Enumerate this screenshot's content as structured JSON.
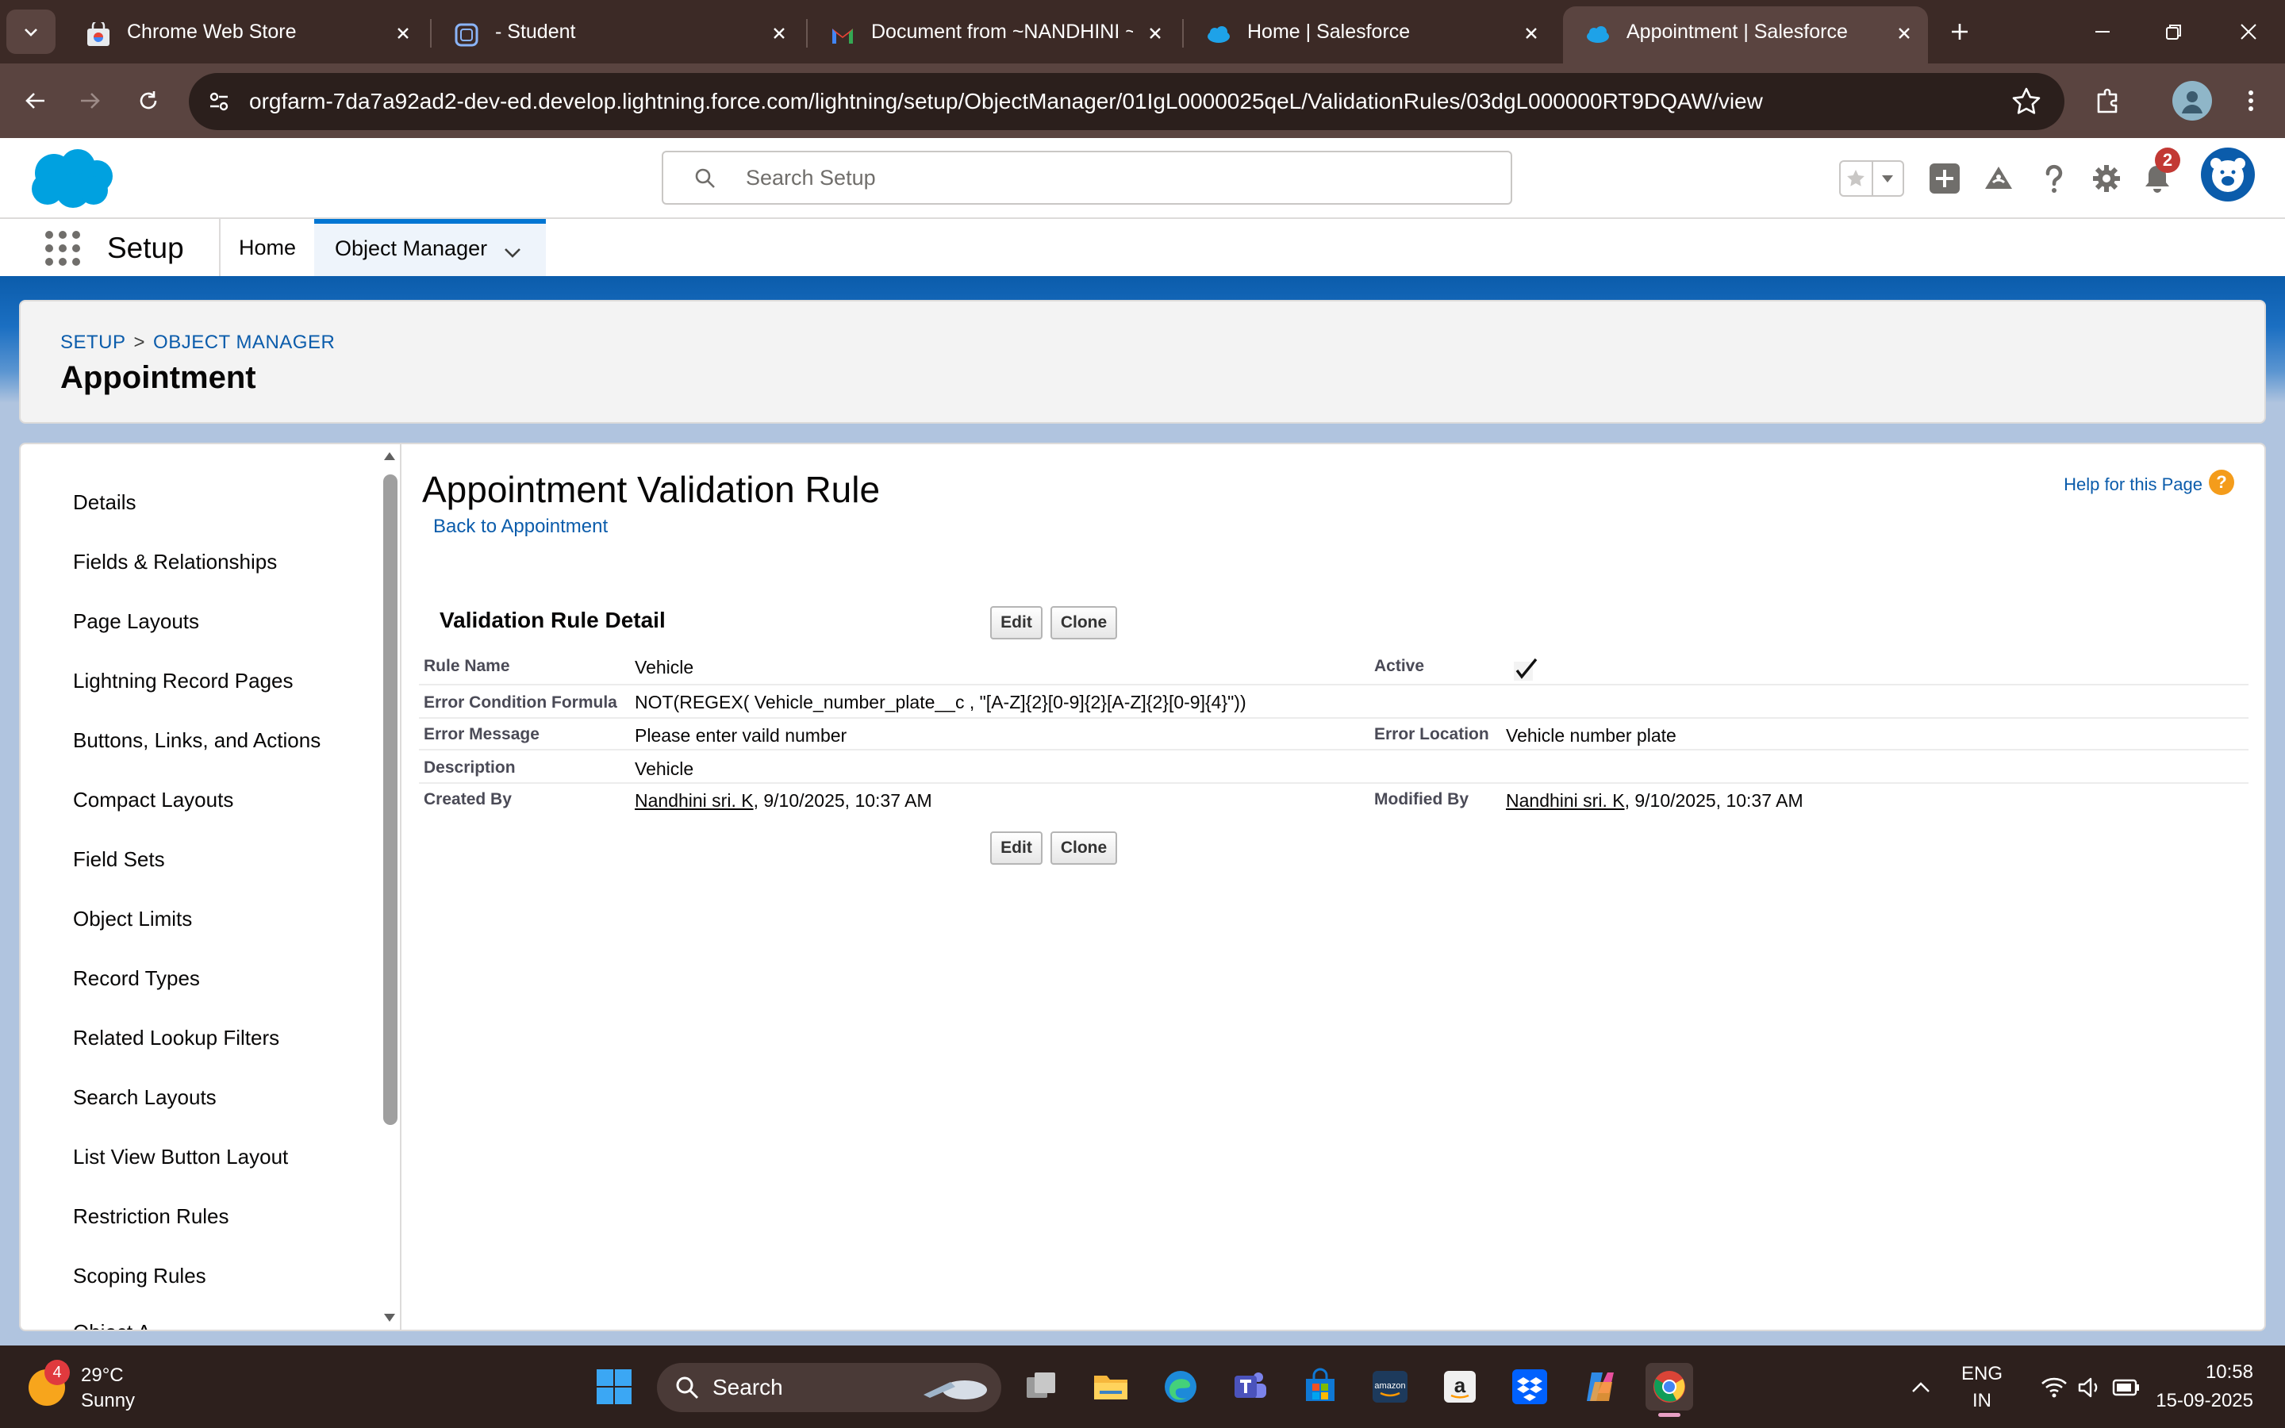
{
  "browser": {
    "tabs": [
      {
        "title": "Chrome Web Store",
        "icon": "chrome-web-store-icon",
        "active": false
      },
      {
        "title": "- Student",
        "icon": "student-app-icon",
        "active": false
      },
      {
        "title": "Document from ~NANDHINI ~",
        "icon": "gmail-icon",
        "active": false
      },
      {
        "title": "Home | Salesforce",
        "icon": "salesforce-cloud-icon",
        "active": false
      },
      {
        "title": "Appointment | Salesforce",
        "icon": "salesforce-cloud-icon",
        "active": true
      }
    ],
    "url": "orgfarm-7da7a92ad2-dev-ed.develop.lightning.force.com/lightning/setup/ObjectManager/01IgL0000025qeL/ValidationRules/03dgL000000RT9DQAW/view"
  },
  "sf_header": {
    "search_placeholder": "Search Setup",
    "notification_count": "2"
  },
  "nav": {
    "app_name": "Setup",
    "items": [
      {
        "label": "Home"
      },
      {
        "label": "Object Manager"
      }
    ]
  },
  "page_header": {
    "breadcrumb": [
      "SETUP",
      "OBJECT MANAGER"
    ],
    "breadcrumb_sep": ">",
    "title": "Appointment"
  },
  "sidebar": {
    "items": [
      {
        "label": "Details"
      },
      {
        "label": "Fields & Relationships"
      },
      {
        "label": "Page Layouts"
      },
      {
        "label": "Lightning Record Pages"
      },
      {
        "label": "Buttons, Links, and Actions"
      },
      {
        "label": "Compact Layouts"
      },
      {
        "label": "Field Sets"
      },
      {
        "label": "Object Limits"
      },
      {
        "label": "Record Types"
      },
      {
        "label": "Related Lookup Filters"
      },
      {
        "label": "Search Layouts"
      },
      {
        "label": "List View Button Layout"
      },
      {
        "label": "Restriction Rules"
      },
      {
        "label": "Scoping Rules"
      },
      {
        "label": "Object A..."
      }
    ]
  },
  "detail": {
    "title": "Appointment Validation Rule",
    "back_link": "Back to Appointment",
    "help_link": "Help for this Page",
    "help_icon_label": "?",
    "section_title": "Validation Rule Detail",
    "edit_label": "Edit",
    "clone_label": "Clone",
    "rule_name_label": "Rule Name",
    "rule_name_value": "Vehicle",
    "active_label": "Active",
    "active_checked": true,
    "formula_label": "Error Condition Formula",
    "formula_value": "NOT(REGEX( Vehicle_number_plate__c , \"[A-Z]{2}[0-9]{2}[A-Z]{2}[0-9]{4}\"))",
    "error_message_label": "Error Message",
    "error_message_value": "Please enter vaild number",
    "error_location_label": "Error Location",
    "error_location_value": "Vehicle number plate",
    "description_label": "Description",
    "description_value": "Vehicle",
    "created_by_label": "Created By",
    "created_by_user": "Nandhini sri. K",
    "created_by_date": ", 9/10/2025, 10:37 AM",
    "modified_by_label": "Modified By",
    "modified_by_user": "Nandhini sri. K",
    "modified_by_date": ", 9/10/2025, 10:37 AM"
  },
  "taskbar": {
    "weather_badge": "4",
    "temperature": "29°C",
    "condition": "Sunny",
    "search_label": "Search",
    "lang_top": "ENG",
    "lang_bottom": "IN",
    "time": "10:58",
    "date": "15-09-2025"
  },
  "colors": {
    "sf_blue": "#0176d3",
    "link_blue": "#0b5cab",
    "chrome_frame": "#3c2a26",
    "chrome_toolbar": "#5a4440",
    "taskbar": "#2d201d"
  }
}
